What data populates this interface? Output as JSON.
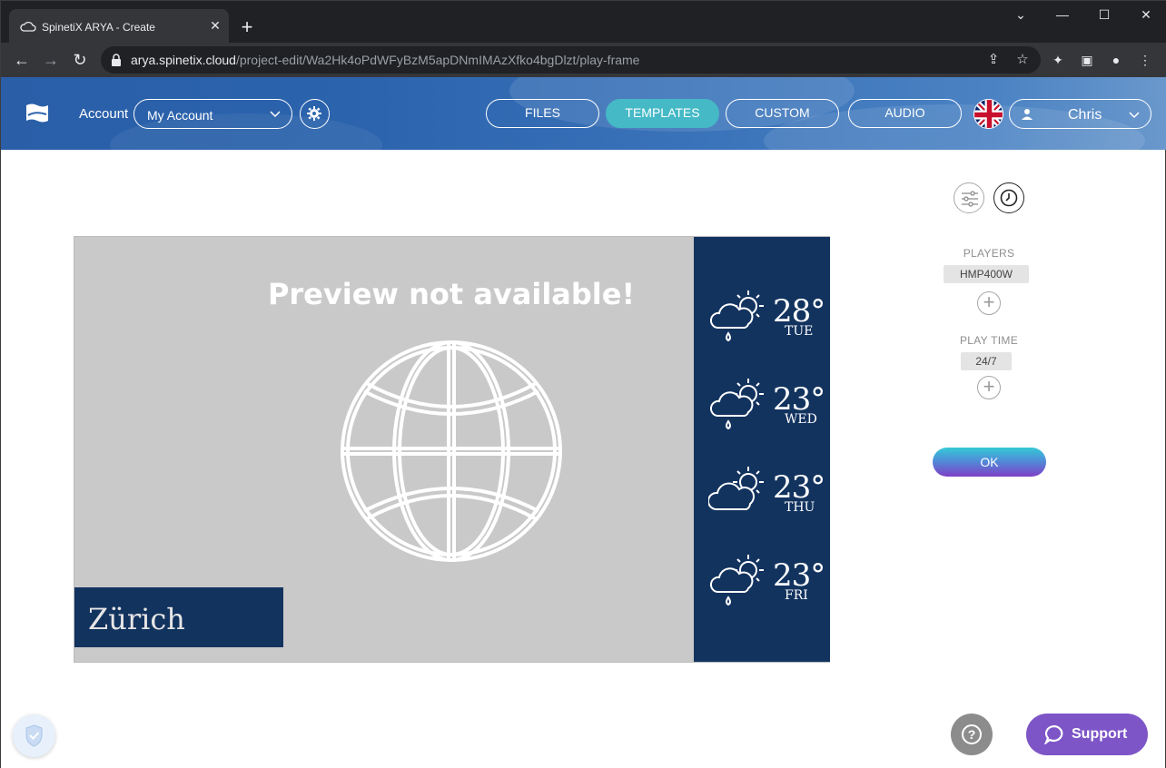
{
  "browser": {
    "tab_title": "SpinetiX ARYA - Create",
    "tab_close": "✕",
    "new_tab": "+",
    "url_host": "arya.spinetix.cloud",
    "url_path": "/project-edit/Wa2Hk4oPdWFyBzM5apDNmIMAzXfko4bgDlzt/play-frame"
  },
  "header": {
    "account_label": "Account",
    "account_value": "My Account",
    "nav": [
      "FILES",
      "TEMPLATES",
      "CUSTOM",
      "AUDIO"
    ],
    "active_nav": "TEMPLATES",
    "user_name": "Chris",
    "language_icon": "uk-flag-icon"
  },
  "preview": {
    "title": "Preview not available!",
    "city": "Zürich",
    "forecast": [
      {
        "temp": "28°",
        "day": "TUE",
        "icon": "rain-sun-cloud-icon"
      },
      {
        "temp": "23°",
        "day": "WED",
        "icon": "rain-sun-cloud-icon"
      },
      {
        "temp": "23°",
        "day": "THU",
        "icon": "sun-cloud-icon"
      },
      {
        "temp": "23°",
        "day": "FRI",
        "icon": "rain-sun-cloud-icon"
      }
    ]
  },
  "side_panel": {
    "players_label": "PLAYERS",
    "player": "HMP400W",
    "playtime_label": "PLAY TIME",
    "playtime": "24/7",
    "add": "+",
    "ok_label": "OK"
  },
  "footer": {
    "help": "?",
    "support_label": "Support"
  },
  "colors": {
    "header_blue": "#2b63ad",
    "active_nav": "#45b9c6",
    "preview_navy": "#13335f",
    "support_purple": "#7d55c7"
  }
}
